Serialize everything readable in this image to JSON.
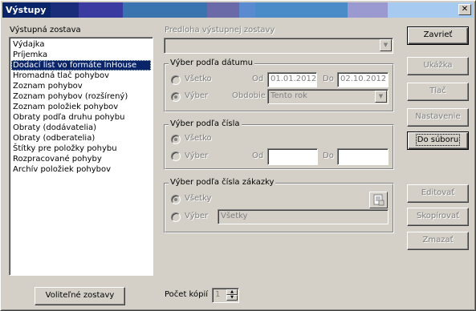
{
  "window": {
    "title": "Výstupy",
    "close_glyph": "✕"
  },
  "output_list": {
    "label": "Výstupná zostava",
    "items": [
      "Výdajka",
      "Príjemka",
      "Dodací list vo formáte InHouse",
      "Hromadná tlač pohybov",
      "Zoznam pohybov",
      "Zoznam pohybov (rozšírený)",
      "Zoznam položiek pohybov",
      "Obraty podľa druhu pohybu",
      "Obraty (dodávatelia)",
      "Obraty (odberatelia)",
      "Štítky pre položky pohybu",
      "Rozpracované pohyby",
      "Archív položiek pohybov"
    ],
    "selected_index": 2
  },
  "template": {
    "label": "Predloha výstupnej zostavy",
    "value": ""
  },
  "by_date": {
    "legend": "Výber podľa dátumu",
    "all_label": "Všetko",
    "select_label": "Výber",
    "from_label": "Od",
    "from_value": "01.01.2012",
    "to_label": "Do",
    "to_value": "02.10.2012",
    "period_label": "Obdobie",
    "period_value": "Tento rok"
  },
  "by_number": {
    "legend": "Výber podľa čísla",
    "all_label": "Všetko",
    "select_label": "Výber",
    "from_label": "Od",
    "from_value": "",
    "to_label": "Do",
    "to_value": ""
  },
  "by_order": {
    "legend": "Výber podľa čísla zákazky",
    "all_label": "Všetky",
    "select_label": "Výber",
    "select_value": "Všetky"
  },
  "buttons": {
    "close": "Zavrieť",
    "preview": "Ukážka",
    "print": "Tlač",
    "settings": "Nastavenie",
    "to_file": "Do súboru",
    "edit": "Editovať",
    "copy": "Skopírovať",
    "delete": "Zmazať",
    "optional_reports": "Voliteľné zostavy"
  },
  "copies": {
    "label": "Počet kópií",
    "value": "1"
  },
  "colors": {
    "face": "#d4d0c8",
    "selection": "#0a246a",
    "disabled_text": "#808080"
  }
}
